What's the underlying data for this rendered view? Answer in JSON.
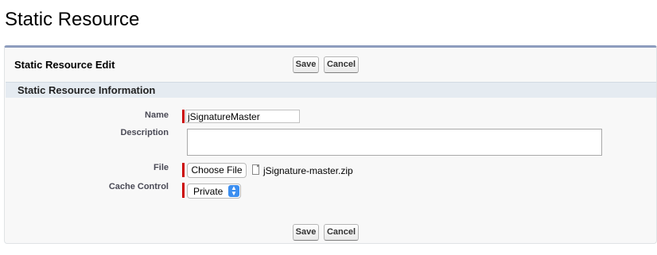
{
  "page": {
    "title": "Static Resource"
  },
  "panel": {
    "title": "Static Resource Edit",
    "save_label": "Save",
    "cancel_label": "Cancel"
  },
  "section": {
    "title": "Static Resource Information"
  },
  "form": {
    "name": {
      "label": "Name",
      "value": "jSignatureMaster",
      "required": true
    },
    "description": {
      "label": "Description",
      "value": ""
    },
    "file": {
      "label": "File",
      "button_label": "Choose File",
      "file_name": "jSignature-master.zip",
      "required": true
    },
    "cache_control": {
      "label": "Cache Control",
      "value": "Private",
      "required": true
    }
  },
  "footer": {
    "save_label": "Save",
    "cancel_label": "Cancel"
  },
  "colors": {
    "required_bar": "#cc0000",
    "panel_accent": "#8e9dbe",
    "section_bg": "#e5ebf1",
    "select_arrow": "#3b8ef0"
  },
  "icons": {
    "file": "file-icon",
    "select_arrow": "chevron-updown-icon"
  }
}
